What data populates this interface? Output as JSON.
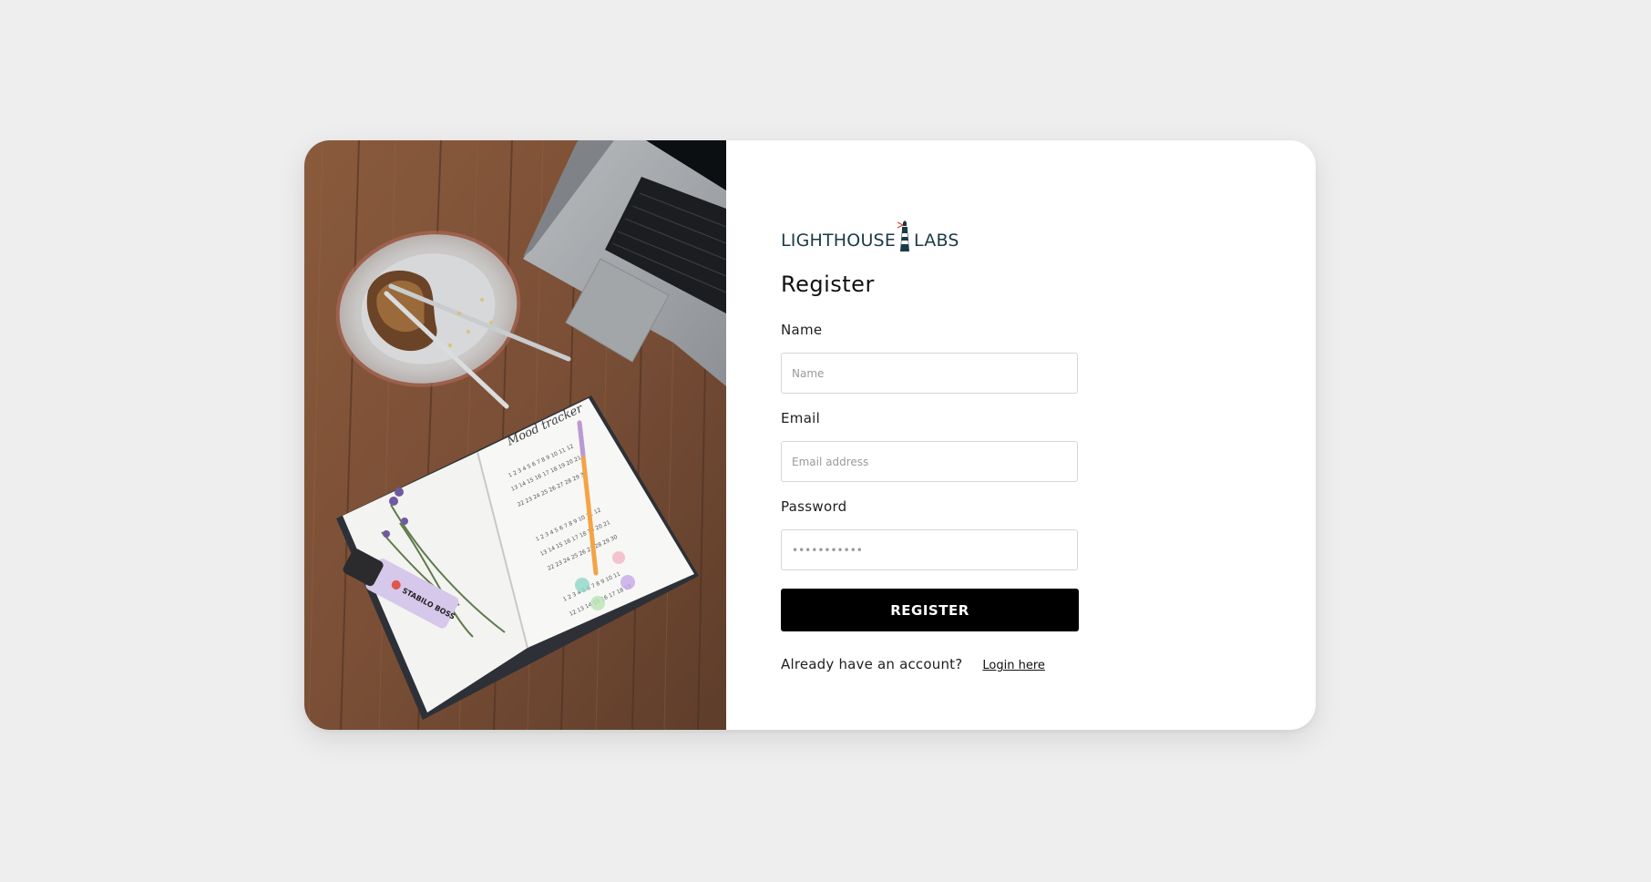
{
  "brand": {
    "logo_left": "LIGHTHOUSE",
    "logo_right": "LABS",
    "logo_color": "#1c3a45",
    "logo_accent": "#e23b3b"
  },
  "form": {
    "title": "Register",
    "name_label": "Name",
    "name_placeholder": "Name",
    "email_label": "Email",
    "email_placeholder": "Email address",
    "password_label": "Password",
    "password_placeholder": "•••••••••••",
    "submit_label": "REGISTER",
    "account_prompt": "Already have an account?",
    "login_link": "Login here"
  },
  "colors": {
    "page_background": "#eeeeee",
    "card_background": "#ffffff",
    "button_background": "#000000",
    "button_text": "#ffffff"
  },
  "hero_image": {
    "marker_label": "STABILO BOSS",
    "journal_heading": "Mood tracker"
  }
}
